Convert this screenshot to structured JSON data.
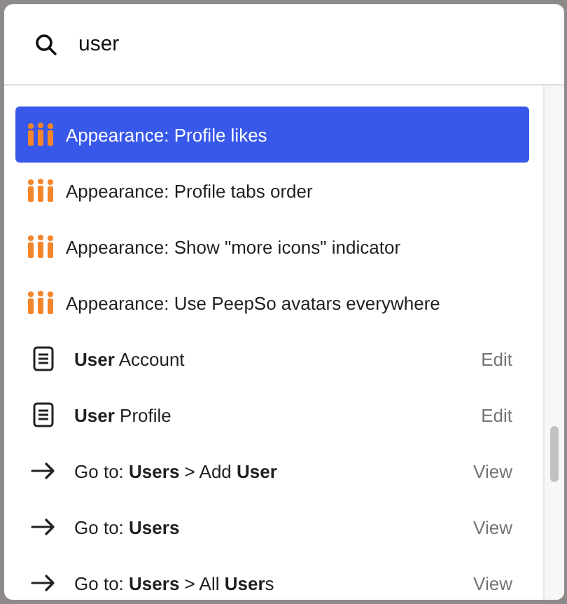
{
  "search": {
    "value": "user"
  },
  "results": [
    {
      "kind": "setting",
      "label": "Appearance: Profile likes",
      "selected": true
    },
    {
      "kind": "setting",
      "label": "Appearance: Profile tabs order",
      "selected": false
    },
    {
      "kind": "setting",
      "label": "Appearance: Show \"more icons\" indicator",
      "selected": false
    },
    {
      "kind": "setting",
      "label": "Appearance: Use PeepSo avatars everywhere",
      "selected": false
    },
    {
      "kind": "page",
      "label": "**User** Account",
      "action": "Edit",
      "selected": false
    },
    {
      "kind": "page",
      "label": "**User** Profile",
      "action": "Edit",
      "selected": false
    },
    {
      "kind": "goto",
      "label": "Go to: **Users** > Add **User**",
      "action": "View",
      "selected": false
    },
    {
      "kind": "goto",
      "label": "Go to: **Users**",
      "action": "View",
      "selected": false
    },
    {
      "kind": "goto",
      "label": "Go to: **Users** > All **User**s",
      "action": "View",
      "selected": false
    }
  ]
}
